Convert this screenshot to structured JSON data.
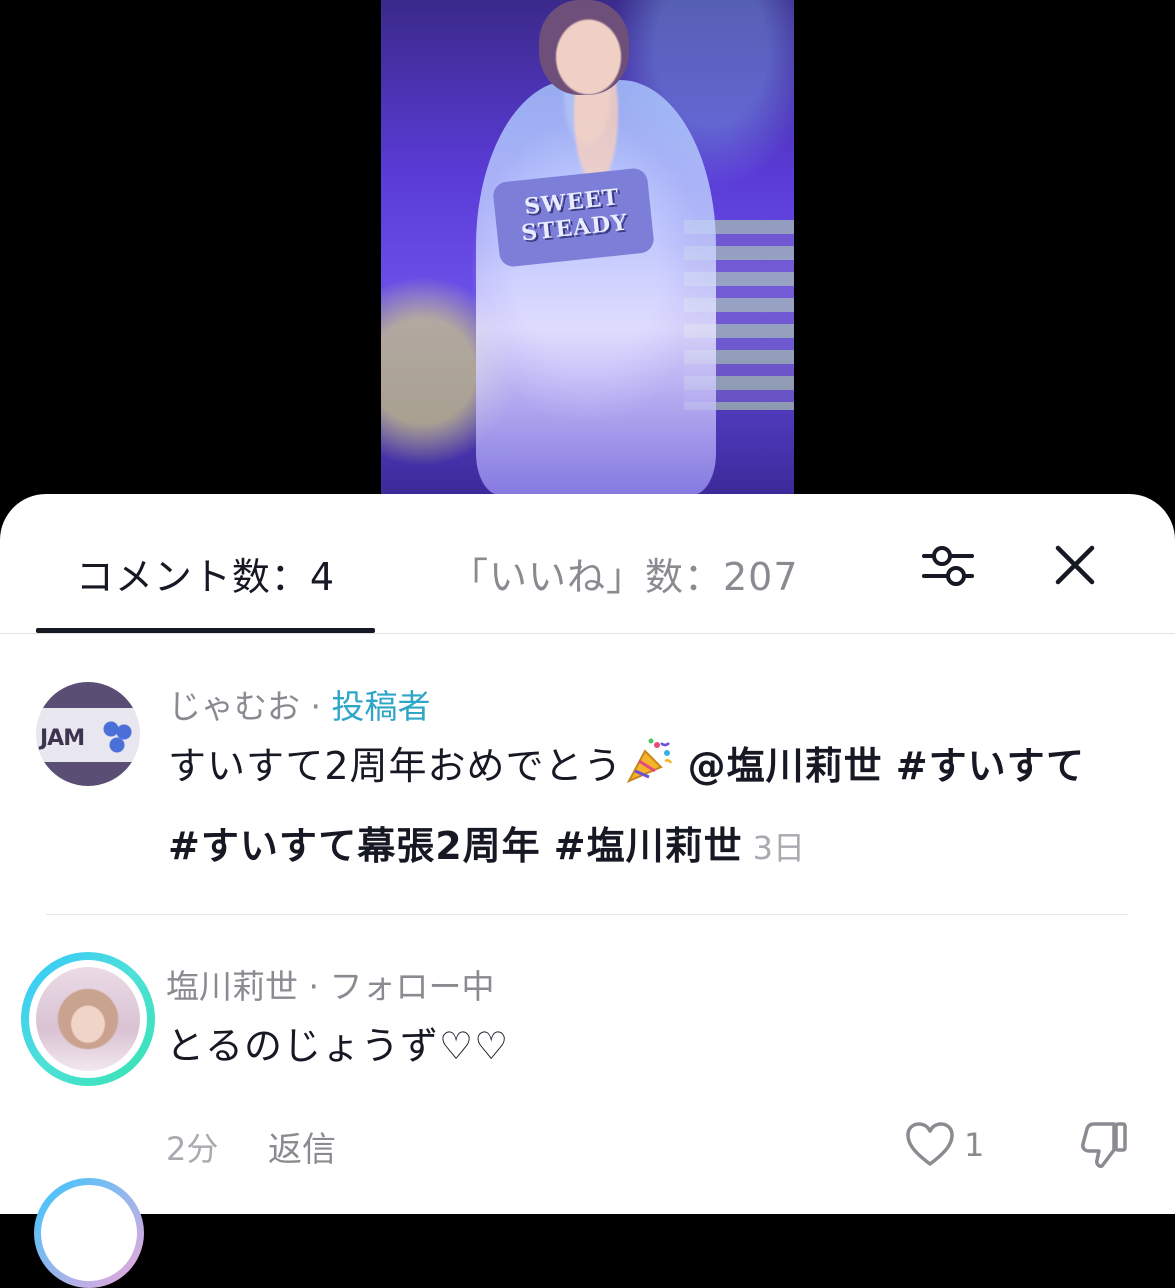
{
  "video": {
    "shirt_logo_text": "SWEET STEADY"
  },
  "sheet": {
    "tabs": {
      "comments_label": "コメント数：4",
      "likes_label": "「いいね」数：207"
    },
    "icons": {
      "filter": "filter-sliders-icon",
      "close": "close-icon"
    }
  },
  "comments": [
    {
      "username": "じゃむお",
      "separator": " · ",
      "badge": "投稿者",
      "avatar_text": "JAM",
      "text_before": "すいすて2周年おめでとう",
      "emoji": "party-popper-icon",
      "text_rest_1": " ",
      "mention": "@塩川莉世",
      "text_rest_2": " ",
      "tag1": "#すいすて",
      "text_rest_3": " ",
      "tag2": "#すいすて幕張2周年",
      "text_rest_4": " ",
      "tag3": "#塩川莉世",
      "time": "3日"
    },
    {
      "username": "塩川莉世",
      "separator": " · ",
      "badge": "フォロー中",
      "text": "とるのじょうず♡♡",
      "time": "2分",
      "reply_label": "返信",
      "like_count": "1"
    }
  ],
  "colors": {
    "accent_author": "#2fa6c8",
    "text_primary": "#161823",
    "text_secondary": "#8a8b91"
  }
}
